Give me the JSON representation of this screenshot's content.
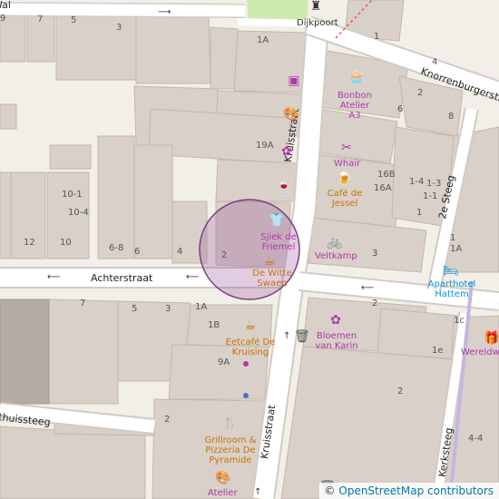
{
  "map": {
    "colors": {
      "land": "#f2efe9",
      "building": "#d9d0c9",
      "building_stroke": "#c4b6ab",
      "road": "#ffffff",
      "road_edge": "#d2cbc4",
      "grass": "#cdebb0",
      "marker_fill": "#9c5a9c",
      "marker_stroke": "#7a3f7a"
    },
    "streets": [
      {
        "name": "Achterstraat"
      },
      {
        "name": "Kruisstraat"
      },
      {
        "name": "Kruisstraat"
      },
      {
        "name": "Knorrenburgerstraat"
      },
      {
        "name": "2e Steeg"
      },
      {
        "name": "Kerksteeg"
      },
      {
        "name": "Gasthuissteeg"
      },
      {
        "name": "Wal"
      }
    ],
    "house_numbers": [
      "9",
      "7",
      "5",
      "3",
      "1A",
      "1",
      "2",
      "4",
      "6",
      "8",
      "10",
      "12",
      "2",
      "1",
      "3",
      "19A",
      "10-1",
      "10-4",
      "12",
      "10",
      "6-8",
      "6",
      "4",
      "2",
      "16B",
      "16A",
      "1-4",
      "1-3",
      "1-1",
      "1",
      "7",
      "5",
      "3",
      "1A",
      "1B",
      "9A",
      "2",
      "1",
      "2",
      "3",
      "1e",
      "1c",
      "1",
      "1A",
      "3",
      "2",
      "4-4",
      "3"
    ],
    "pois": [
      {
        "name": "Dijkpoort",
        "icon": "tower-icon",
        "color": "#333333"
      },
      {
        "name": "Bonbon Atelier A3",
        "icon": "cake-icon",
        "color": "#ac39ac"
      },
      {
        "name": "Whair",
        "icon": "hairdresser-icon",
        "color": "#ac39ac"
      },
      {
        "name": "Café de Jessel",
        "icon": "beer-icon",
        "color": "#c77400"
      },
      {
        "name": "Sjiek de Friemel",
        "icon": "clothes-icon",
        "color": "#ac39ac"
      },
      {
        "name": "De Witte Swaen",
        "icon": "coffee-icon",
        "color": "#c77400"
      },
      {
        "name": "Veltkamp",
        "icon": "bicycle-icon",
        "color": "#ac39ac"
      },
      {
        "name": "Aparthotel Hattem",
        "icon": "bed-icon",
        "color": "#0092da"
      },
      {
        "name": "Bloemen van Karin",
        "icon": "flower-icon",
        "color": "#ac39ac"
      },
      {
        "name": "Eetcafé De Kruising",
        "icon": "coffee-icon",
        "color": "#c77400"
      },
      {
        "name": "Grillroom & Pizzeria De Pyramide",
        "icon": "fastfood-icon",
        "color": "#c77400"
      },
      {
        "name": "Atelier",
        "icon": "palette-icon",
        "color": "#333333"
      },
      {
        "name": "Wereldw",
        "icon": "gift-icon",
        "color": "#ac39ac"
      }
    ],
    "other_icons": [
      "laundry-icon",
      "palette-icon",
      "flower-icon",
      "wine-icon",
      "waste-basket-icon",
      "waste-basket-icon"
    ],
    "attribution": {
      "prefix": "©",
      "link_text": "OpenStreetMap contributors"
    }
  }
}
